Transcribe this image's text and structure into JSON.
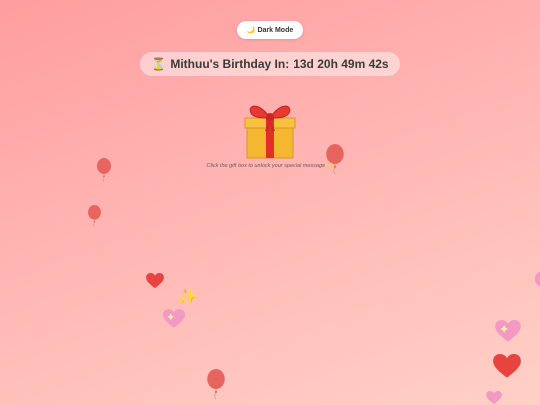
{
  "toolbar": {
    "dark_mode_label": "Dark Mode",
    "moon_icon": "moon-icon"
  },
  "countdown": {
    "icon": "hourglass-icon",
    "prefix": "Mithuu's Birthday In:",
    "value": "13d 20h 49m 42s"
  },
  "gift": {
    "icon": "gift-icon",
    "hint": "Click the gift box to unlock your special message",
    "hint_icon": "sparkle-icon"
  },
  "decorations": {
    "balloon_color": "#e8645f",
    "heart_color": "#e8443f",
    "sparkle_heart_color": "#f39ac4"
  }
}
